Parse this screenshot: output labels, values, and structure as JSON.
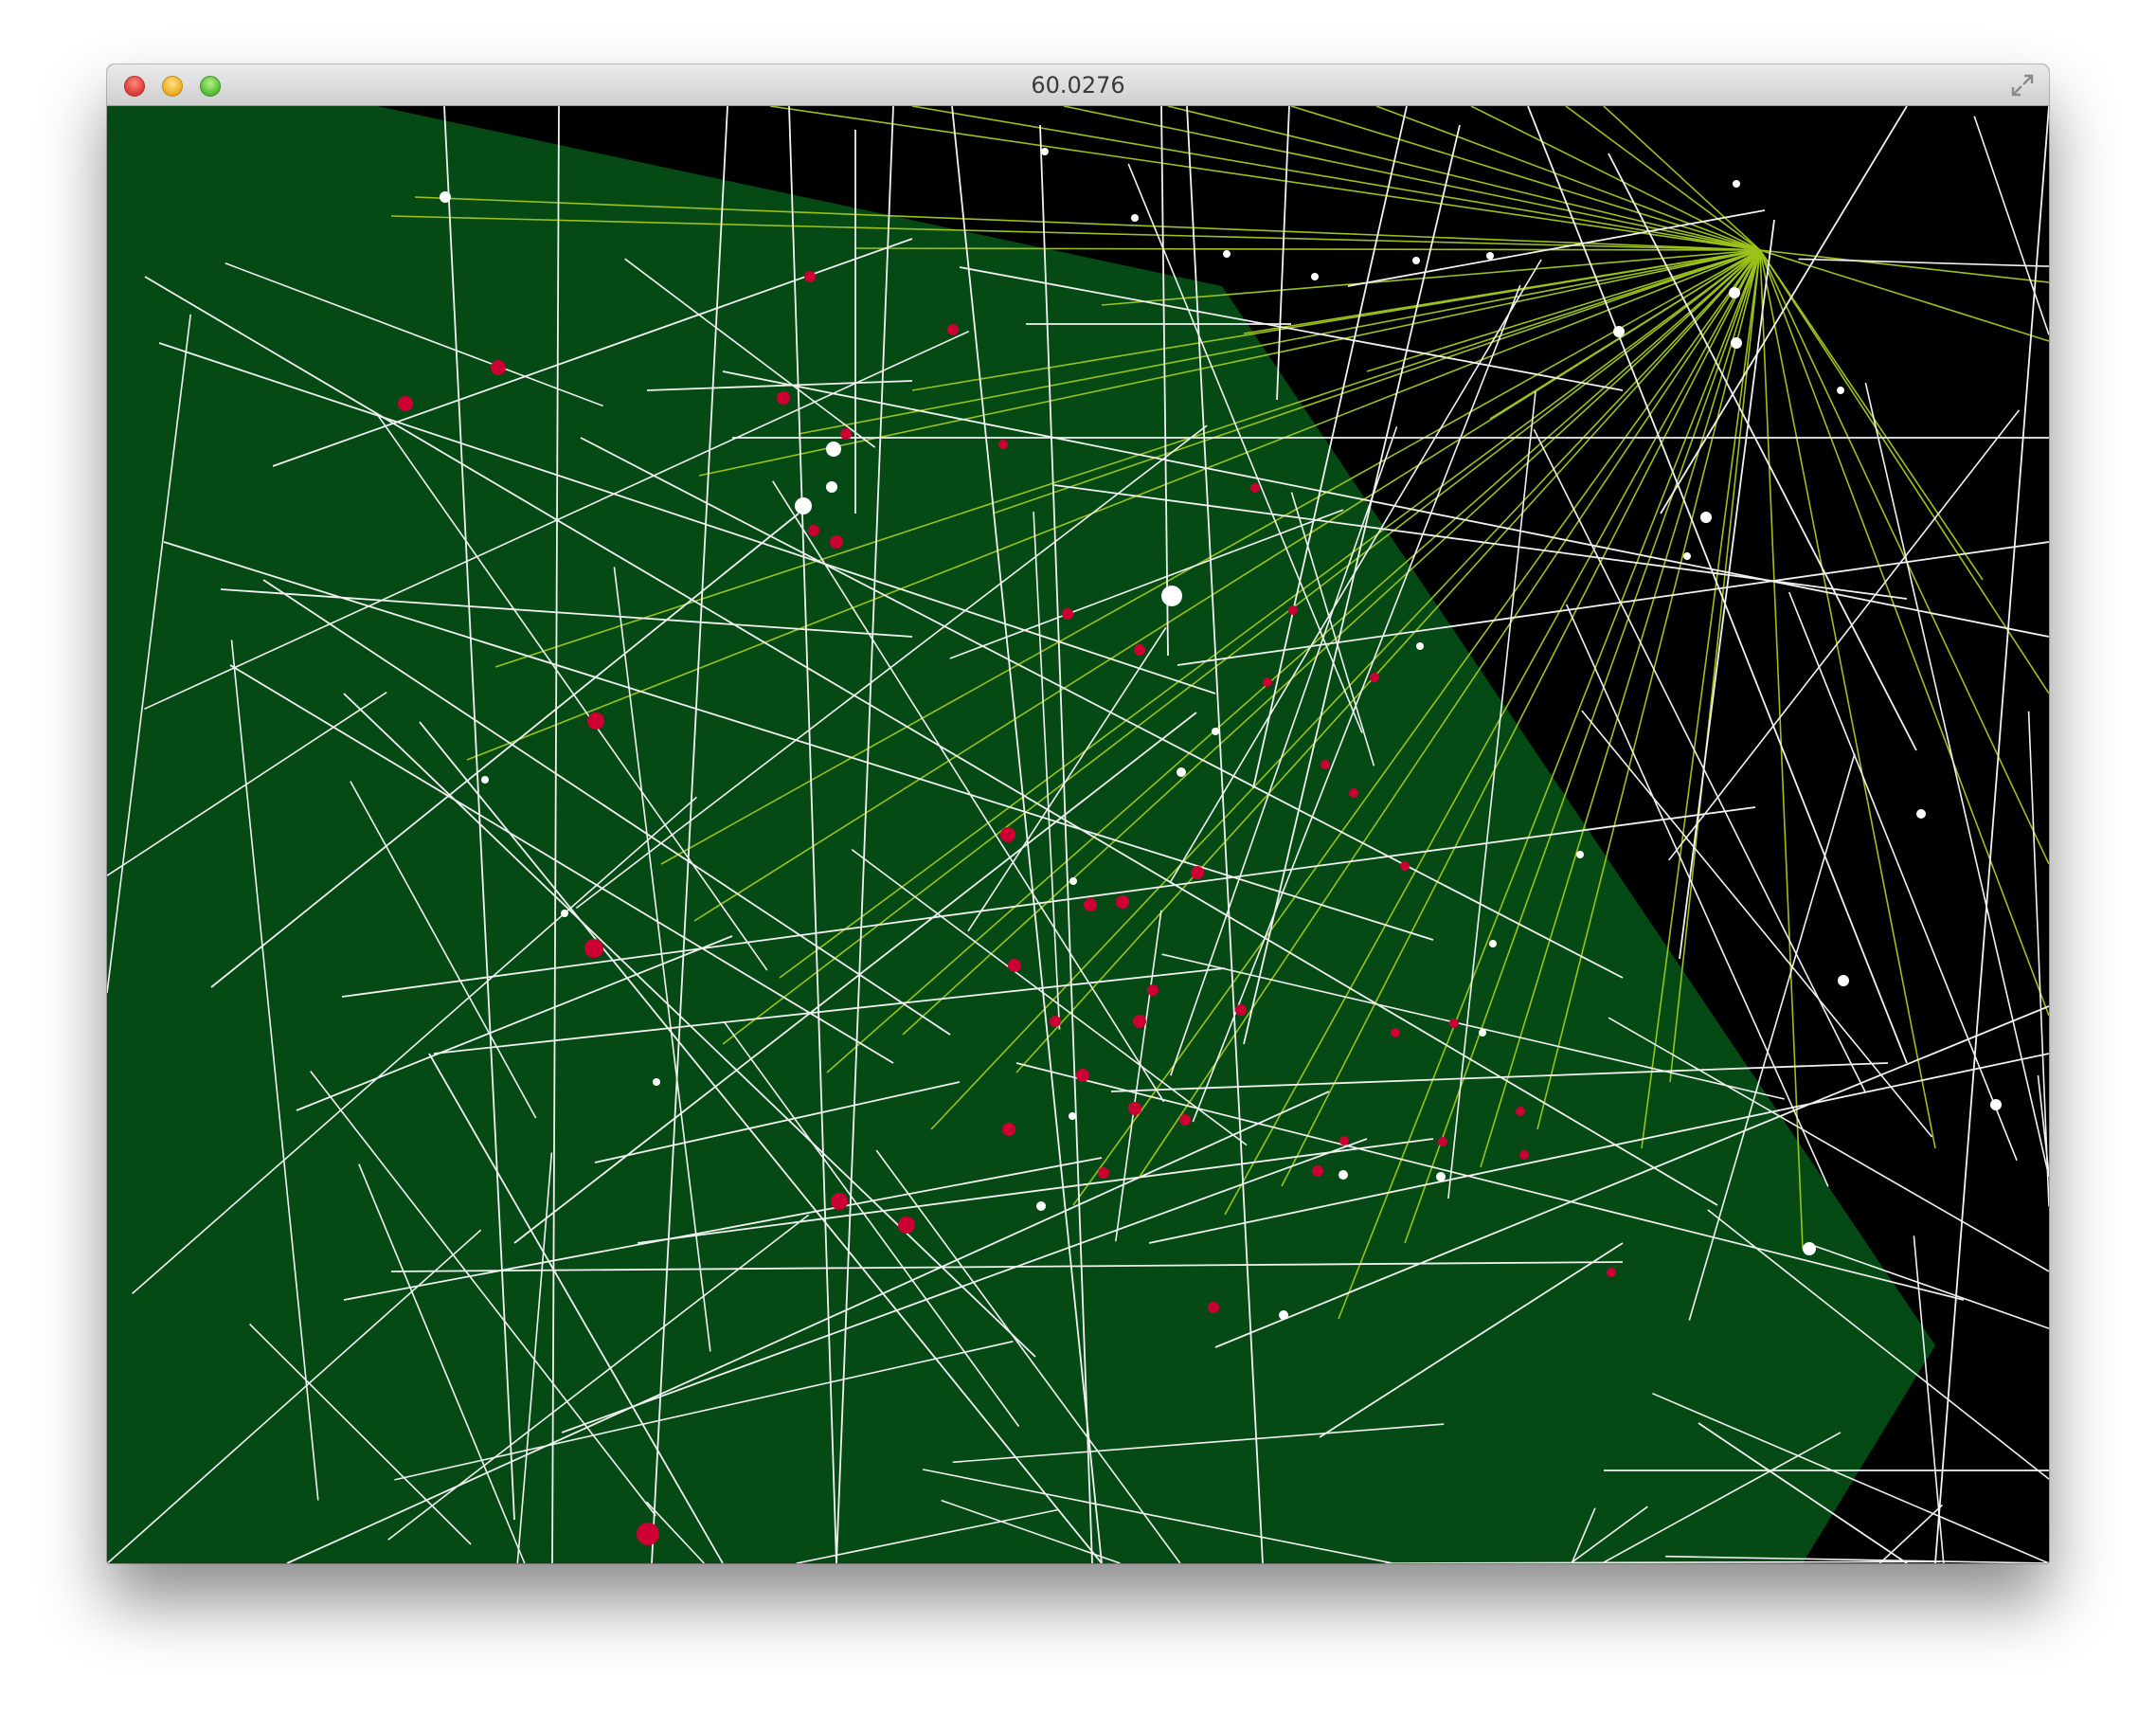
{
  "window": {
    "title": "60.0276"
  },
  "icons": {
    "close": "close-icon",
    "minimize": "minimize-icon",
    "zoom": "zoom-icon",
    "fullscreen": "fullscreen-arrows-icon"
  },
  "colors": {
    "background": "#000000",
    "polygon": "#054a14",
    "white_lines": "#f2f2f2",
    "ray_lines": "#9ac21a",
    "red_markers": "#cc0033",
    "white_markers": "#ffffff"
  }
}
